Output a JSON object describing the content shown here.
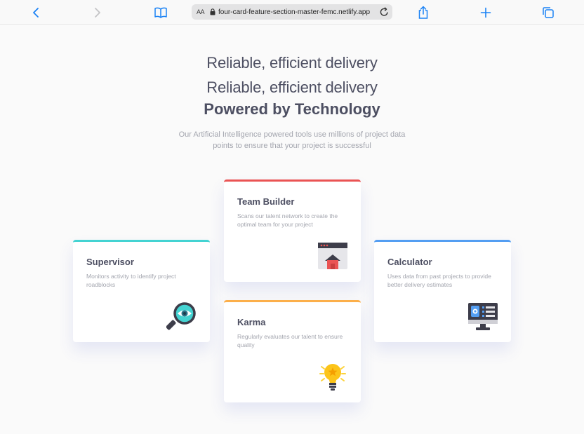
{
  "browser": {
    "address": {
      "text_size_label": "AA",
      "url": "four-card-feature-section-master-femc.netlify.app"
    },
    "icons": [
      "back-icon",
      "forward-icon",
      "bookmarks-icon",
      "lock-icon",
      "reload-icon",
      "share-icon",
      "new-tab-icon",
      "tabs-icon"
    ]
  },
  "header": {
    "line1": "Reliable, efficient delivery",
    "line2": "Reliable, efficient delivery",
    "title": "Powered by Technology",
    "description": "Our Artificial Intelligence powered tools use millions of project data points to ensure that your project is successful"
  },
  "cards": [
    {
      "title": "Supervisor",
      "description": "Monitors activity to identify project roadblocks",
      "accent": "#44d3d2",
      "icon": "magnifier-eye-icon"
    },
    {
      "title": "Team Builder",
      "description": "Scans our talent network to create the optimal team for your project",
      "accent": "#ea5353",
      "icon": "team-builder-icon"
    },
    {
      "title": "Karma",
      "description": "Regularly evaluates our talent to ensure quality",
      "accent": "#fcaf4a",
      "icon": "lightbulb-icon"
    },
    {
      "title": "Calculator",
      "description": "Uses data from past projects to provide better delivery estimates",
      "accent": "#549ef2",
      "icon": "calculator-monitor-icon"
    }
  ],
  "colors": {
    "title": "#4d4f62",
    "text": "#a3a5ae",
    "background": "#fafafa",
    "browser_blue": "#1a82f5"
  }
}
